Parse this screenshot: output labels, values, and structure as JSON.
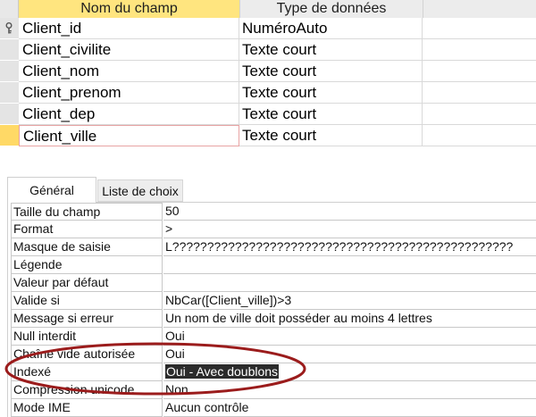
{
  "table_design": {
    "headers": {
      "field_name": "Nom du champ",
      "data_type": "Type de données"
    },
    "rows": [
      {
        "name": "Client_id",
        "type": "NuméroAuto",
        "primary_key": true
      },
      {
        "name": "Client_civilite",
        "type": "Texte court"
      },
      {
        "name": "Client_nom",
        "type": "Texte court"
      },
      {
        "name": "Client_prenom",
        "type": "Texte court"
      },
      {
        "name": "Client_dep",
        "type": "Texte court"
      },
      {
        "name": "Client_ville",
        "type": "Texte court",
        "selected": true
      }
    ]
  },
  "field_properties": {
    "tabs": [
      "Général",
      "Liste de choix"
    ],
    "active_tab": "Général",
    "rows": [
      {
        "label": "Taille du champ",
        "value": "50"
      },
      {
        "label": "Format",
        "value": ">"
      },
      {
        "label": "Masque de saisie",
        "value": "L?????????????????????????????????????????????????"
      },
      {
        "label": "Légende",
        "value": ""
      },
      {
        "label": "Valeur par défaut",
        "value": ""
      },
      {
        "label": "Valide si",
        "value": "NbCar([Client_ville])>3"
      },
      {
        "label": "Message si erreur",
        "value": "Un nom de ville doit posséder au moins 4 lettres"
      },
      {
        "label": "Null interdit",
        "value": "Oui"
      },
      {
        "label": "Chaîne vide autorisée",
        "value": "Oui"
      },
      {
        "label": "Indexé",
        "value": "Oui - Avec doublons",
        "highlighted": true
      },
      {
        "label": "Compression unicode",
        "value": "Non"
      },
      {
        "label": "Mode IME",
        "value": "Aucun contrôle"
      }
    ]
  },
  "colors": {
    "header_active": "#ffe57f",
    "row_selector_active": "#ffd966",
    "annotation_ellipse": "#9b1c1c",
    "value_highlight": "#2b2b2b"
  },
  "icons": {
    "primary_key": "key-icon"
  }
}
